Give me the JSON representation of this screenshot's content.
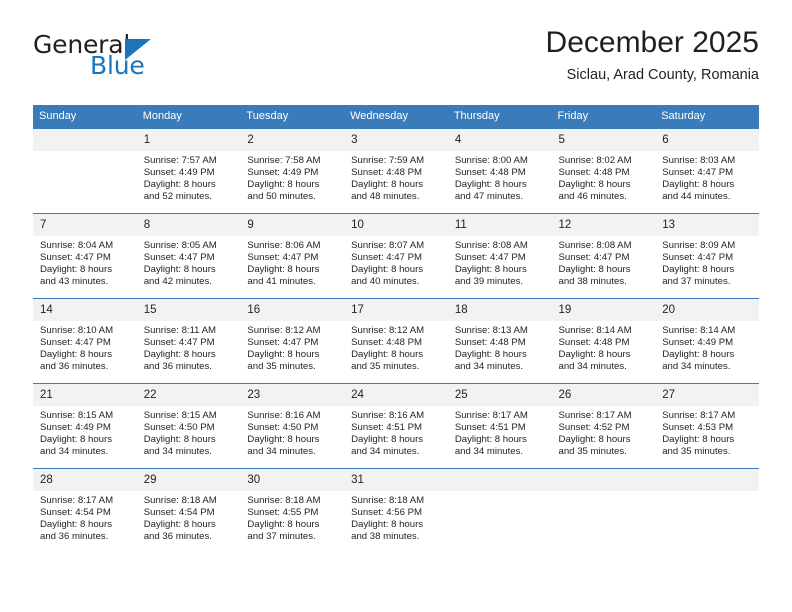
{
  "brand": {
    "name_top": "General",
    "name_bottom": "Blue",
    "accent_color": "#1b75bc"
  },
  "header": {
    "title": "December 2025",
    "subtitle": "Siclau, Arad County, Romania"
  },
  "theme": {
    "header_row_bg": "#3a7cba",
    "daynum_bg": "#f2f2f2",
    "text_color": "#231f20"
  },
  "weekdays": [
    "Sunday",
    "Monday",
    "Tuesday",
    "Wednesday",
    "Thursday",
    "Friday",
    "Saturday"
  ],
  "weeks": [
    [
      {
        "day": "",
        "sunrise": "",
        "sunset": "",
        "daylight1": "",
        "daylight2": "",
        "empty": true
      },
      {
        "day": "1",
        "sunrise": "Sunrise: 7:57 AM",
        "sunset": "Sunset: 4:49 PM",
        "daylight1": "Daylight: 8 hours",
        "daylight2": "and 52 minutes.",
        "empty": false
      },
      {
        "day": "2",
        "sunrise": "Sunrise: 7:58 AM",
        "sunset": "Sunset: 4:49 PM",
        "daylight1": "Daylight: 8 hours",
        "daylight2": "and 50 minutes.",
        "empty": false
      },
      {
        "day": "3",
        "sunrise": "Sunrise: 7:59 AM",
        "sunset": "Sunset: 4:48 PM",
        "daylight1": "Daylight: 8 hours",
        "daylight2": "and 48 minutes.",
        "empty": false
      },
      {
        "day": "4",
        "sunrise": "Sunrise: 8:00 AM",
        "sunset": "Sunset: 4:48 PM",
        "daylight1": "Daylight: 8 hours",
        "daylight2": "and 47 minutes.",
        "empty": false
      },
      {
        "day": "5",
        "sunrise": "Sunrise: 8:02 AM",
        "sunset": "Sunset: 4:48 PM",
        "daylight1": "Daylight: 8 hours",
        "daylight2": "and 46 minutes.",
        "empty": false
      },
      {
        "day": "6",
        "sunrise": "Sunrise: 8:03 AM",
        "sunset": "Sunset: 4:47 PM",
        "daylight1": "Daylight: 8 hours",
        "daylight2": "and 44 minutes.",
        "empty": false
      }
    ],
    [
      {
        "day": "7",
        "sunrise": "Sunrise: 8:04 AM",
        "sunset": "Sunset: 4:47 PM",
        "daylight1": "Daylight: 8 hours",
        "daylight2": "and 43 minutes.",
        "empty": false
      },
      {
        "day": "8",
        "sunrise": "Sunrise: 8:05 AM",
        "sunset": "Sunset: 4:47 PM",
        "daylight1": "Daylight: 8 hours",
        "daylight2": "and 42 minutes.",
        "empty": false
      },
      {
        "day": "9",
        "sunrise": "Sunrise: 8:06 AM",
        "sunset": "Sunset: 4:47 PM",
        "daylight1": "Daylight: 8 hours",
        "daylight2": "and 41 minutes.",
        "empty": false
      },
      {
        "day": "10",
        "sunrise": "Sunrise: 8:07 AM",
        "sunset": "Sunset: 4:47 PM",
        "daylight1": "Daylight: 8 hours",
        "daylight2": "and 40 minutes.",
        "empty": false
      },
      {
        "day": "11",
        "sunrise": "Sunrise: 8:08 AM",
        "sunset": "Sunset: 4:47 PM",
        "daylight1": "Daylight: 8 hours",
        "daylight2": "and 39 minutes.",
        "empty": false
      },
      {
        "day": "12",
        "sunrise": "Sunrise: 8:08 AM",
        "sunset": "Sunset: 4:47 PM",
        "daylight1": "Daylight: 8 hours",
        "daylight2": "and 38 minutes.",
        "empty": false
      },
      {
        "day": "13",
        "sunrise": "Sunrise: 8:09 AM",
        "sunset": "Sunset: 4:47 PM",
        "daylight1": "Daylight: 8 hours",
        "daylight2": "and 37 minutes.",
        "empty": false
      }
    ],
    [
      {
        "day": "14",
        "sunrise": "Sunrise: 8:10 AM",
        "sunset": "Sunset: 4:47 PM",
        "daylight1": "Daylight: 8 hours",
        "daylight2": "and 36 minutes.",
        "empty": false
      },
      {
        "day": "15",
        "sunrise": "Sunrise: 8:11 AM",
        "sunset": "Sunset: 4:47 PM",
        "daylight1": "Daylight: 8 hours",
        "daylight2": "and 36 minutes.",
        "empty": false
      },
      {
        "day": "16",
        "sunrise": "Sunrise: 8:12 AM",
        "sunset": "Sunset: 4:47 PM",
        "daylight1": "Daylight: 8 hours",
        "daylight2": "and 35 minutes.",
        "empty": false
      },
      {
        "day": "17",
        "sunrise": "Sunrise: 8:12 AM",
        "sunset": "Sunset: 4:48 PM",
        "daylight1": "Daylight: 8 hours",
        "daylight2": "and 35 minutes.",
        "empty": false
      },
      {
        "day": "18",
        "sunrise": "Sunrise: 8:13 AM",
        "sunset": "Sunset: 4:48 PM",
        "daylight1": "Daylight: 8 hours",
        "daylight2": "and 34 minutes.",
        "empty": false
      },
      {
        "day": "19",
        "sunrise": "Sunrise: 8:14 AM",
        "sunset": "Sunset: 4:48 PM",
        "daylight1": "Daylight: 8 hours",
        "daylight2": "and 34 minutes.",
        "empty": false
      },
      {
        "day": "20",
        "sunrise": "Sunrise: 8:14 AM",
        "sunset": "Sunset: 4:49 PM",
        "daylight1": "Daylight: 8 hours",
        "daylight2": "and 34 minutes.",
        "empty": false
      }
    ],
    [
      {
        "day": "21",
        "sunrise": "Sunrise: 8:15 AM",
        "sunset": "Sunset: 4:49 PM",
        "daylight1": "Daylight: 8 hours",
        "daylight2": "and 34 minutes.",
        "empty": false
      },
      {
        "day": "22",
        "sunrise": "Sunrise: 8:15 AM",
        "sunset": "Sunset: 4:50 PM",
        "daylight1": "Daylight: 8 hours",
        "daylight2": "and 34 minutes.",
        "empty": false
      },
      {
        "day": "23",
        "sunrise": "Sunrise: 8:16 AM",
        "sunset": "Sunset: 4:50 PM",
        "daylight1": "Daylight: 8 hours",
        "daylight2": "and 34 minutes.",
        "empty": false
      },
      {
        "day": "24",
        "sunrise": "Sunrise: 8:16 AM",
        "sunset": "Sunset: 4:51 PM",
        "daylight1": "Daylight: 8 hours",
        "daylight2": "and 34 minutes.",
        "empty": false
      },
      {
        "day": "25",
        "sunrise": "Sunrise: 8:17 AM",
        "sunset": "Sunset: 4:51 PM",
        "daylight1": "Daylight: 8 hours",
        "daylight2": "and 34 minutes.",
        "empty": false
      },
      {
        "day": "26",
        "sunrise": "Sunrise: 8:17 AM",
        "sunset": "Sunset: 4:52 PM",
        "daylight1": "Daylight: 8 hours",
        "daylight2": "and 35 minutes.",
        "empty": false
      },
      {
        "day": "27",
        "sunrise": "Sunrise: 8:17 AM",
        "sunset": "Sunset: 4:53 PM",
        "daylight1": "Daylight: 8 hours",
        "daylight2": "and 35 minutes.",
        "empty": false
      }
    ],
    [
      {
        "day": "28",
        "sunrise": "Sunrise: 8:17 AM",
        "sunset": "Sunset: 4:54 PM",
        "daylight1": "Daylight: 8 hours",
        "daylight2": "and 36 minutes.",
        "empty": false
      },
      {
        "day": "29",
        "sunrise": "Sunrise: 8:18 AM",
        "sunset": "Sunset: 4:54 PM",
        "daylight1": "Daylight: 8 hours",
        "daylight2": "and 36 minutes.",
        "empty": false
      },
      {
        "day": "30",
        "sunrise": "Sunrise: 8:18 AM",
        "sunset": "Sunset: 4:55 PM",
        "daylight1": "Daylight: 8 hours",
        "daylight2": "and 37 minutes.",
        "empty": false
      },
      {
        "day": "31",
        "sunrise": "Sunrise: 8:18 AM",
        "sunset": "Sunset: 4:56 PM",
        "daylight1": "Daylight: 8 hours",
        "daylight2": "and 38 minutes.",
        "empty": false
      },
      {
        "day": "",
        "sunrise": "",
        "sunset": "",
        "daylight1": "",
        "daylight2": "",
        "empty": true
      },
      {
        "day": "",
        "sunrise": "",
        "sunset": "",
        "daylight1": "",
        "daylight2": "",
        "empty": true
      },
      {
        "day": "",
        "sunrise": "",
        "sunset": "",
        "daylight1": "",
        "daylight2": "",
        "empty": true
      }
    ]
  ]
}
